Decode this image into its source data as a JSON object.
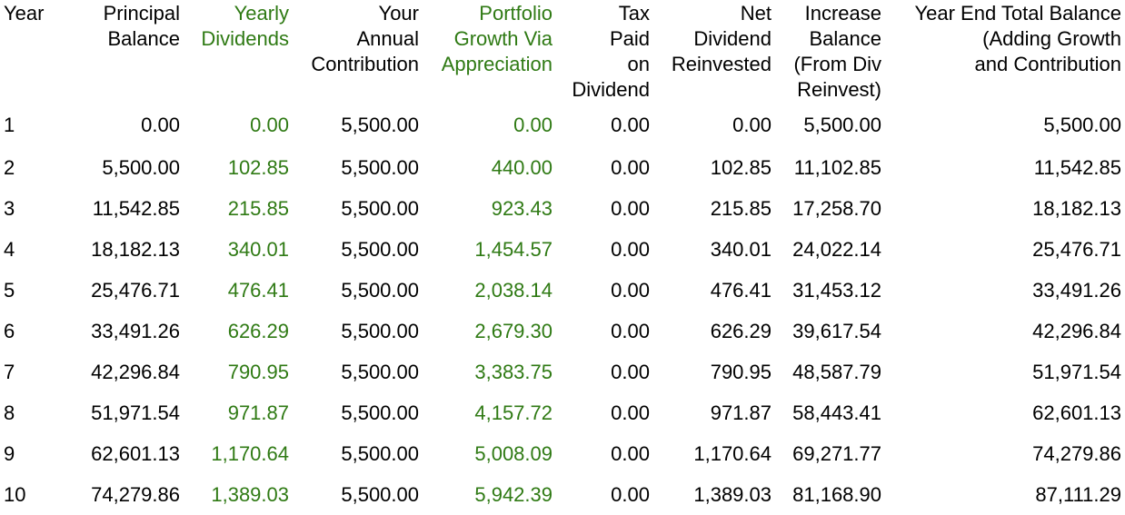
{
  "headers": [
    {
      "label": "Year",
      "green": false
    },
    {
      "label": "Principal\nBalance",
      "green": false
    },
    {
      "label": "Yearly\nDividends",
      "green": true
    },
    {
      "label": "Your\nAnnual\nContribution",
      "green": false
    },
    {
      "label": "Portfolio\nGrowth Via\nAppreciation",
      "green": true
    },
    {
      "label": "Tax\nPaid\non\nDividend",
      "green": false
    },
    {
      "label": "Net\nDividend\nReinvested",
      "green": false
    },
    {
      "label": "Increase\nBalance\n(From Div\nReinvest)",
      "green": false
    },
    {
      "label": "Year End Total Balance\n(Adding Growth\nand Contribution",
      "green": false
    }
  ],
  "rows": [
    [
      "1",
      "0.00",
      "0.00",
      "5,500.00",
      "0.00",
      "0.00",
      "0.00",
      "5,500.00",
      "5,500.00"
    ],
    [
      "2",
      "5,500.00",
      "102.85",
      "5,500.00",
      "440.00",
      "0.00",
      "102.85",
      "11,102.85",
      "11,542.85"
    ],
    [
      "3",
      "11,542.85",
      "215.85",
      "5,500.00",
      "923.43",
      "0.00",
      "215.85",
      "17,258.70",
      "18,182.13"
    ],
    [
      "4",
      "18,182.13",
      "340.01",
      "5,500.00",
      "1,454.57",
      "0.00",
      "340.01",
      "24,022.14",
      "25,476.71"
    ],
    [
      "5",
      "25,476.71",
      "476.41",
      "5,500.00",
      "2,038.14",
      "0.00",
      "476.41",
      "31,453.12",
      "33,491.26"
    ],
    [
      "6",
      "33,491.26",
      "626.29",
      "5,500.00",
      "2,679.30",
      "0.00",
      "626.29",
      "39,617.54",
      "42,296.84"
    ],
    [
      "7",
      "42,296.84",
      "790.95",
      "5,500.00",
      "3,383.75",
      "0.00",
      "790.95",
      "48,587.79",
      "51,971.54"
    ],
    [
      "8",
      "51,971.54",
      "971.87",
      "5,500.00",
      "4,157.72",
      "0.00",
      "971.87",
      "58,443.41",
      "62,601.13"
    ],
    [
      "9",
      "62,601.13",
      "1,170.64",
      "5,500.00",
      "5,008.09",
      "0.00",
      "1,170.64",
      "69,271.77",
      "74,279.86"
    ],
    [
      "10",
      "74,279.86",
      "1,389.03",
      "5,500.00",
      "5,942.39",
      "0.00",
      "1,389.03",
      "81,168.90",
      "87,111.29"
    ]
  ],
  "colors": {
    "text": "#000000",
    "accent_green": "#2f7a14",
    "background": "#ffffff"
  }
}
